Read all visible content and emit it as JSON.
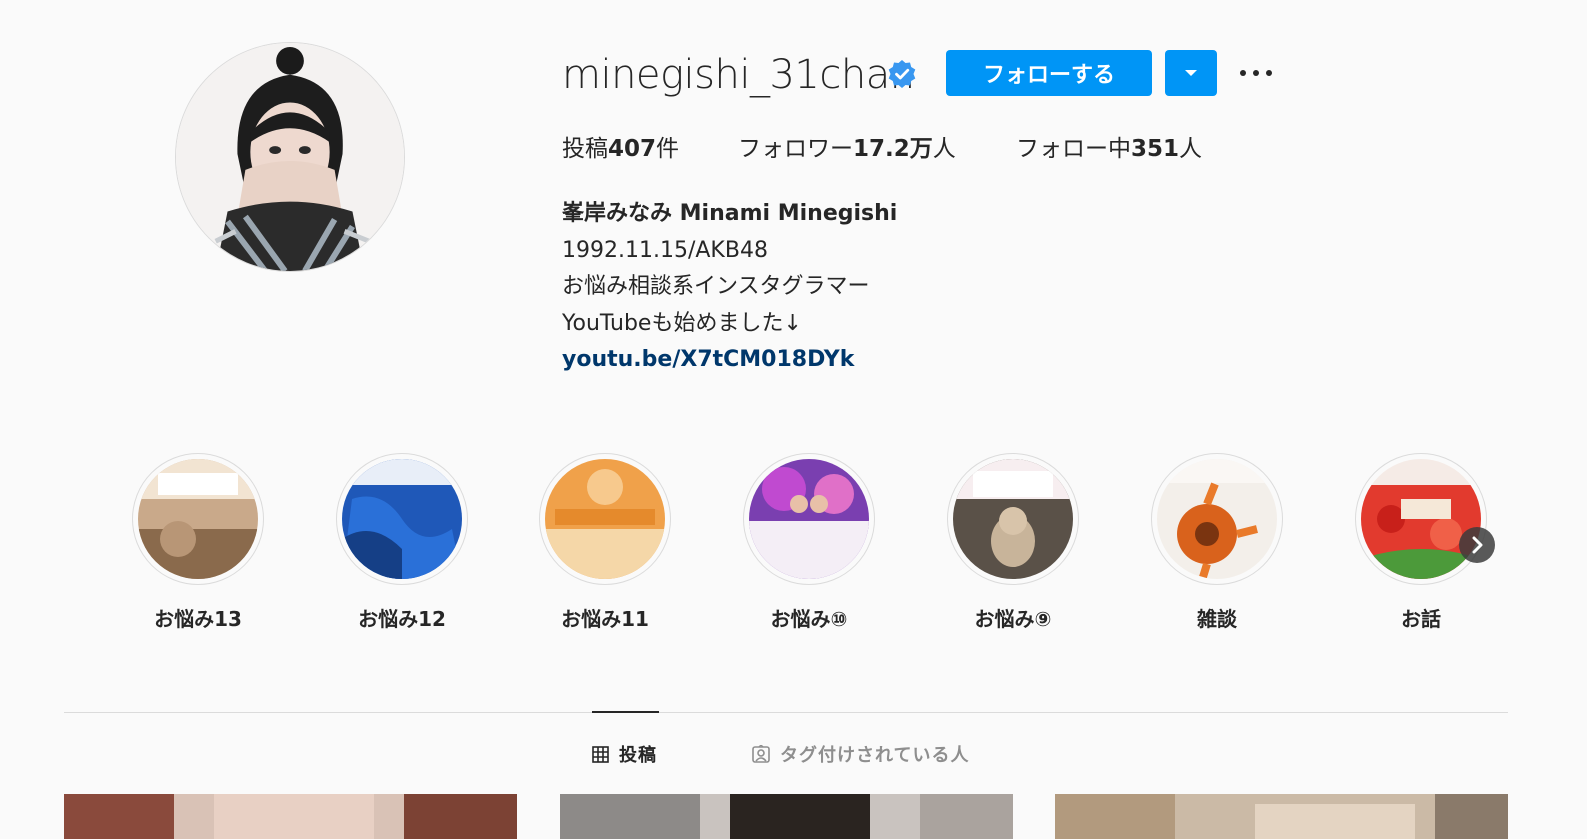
{
  "profile": {
    "username": "minegishi_31chan",
    "verified": true,
    "follow_label": "フォローする",
    "stats": {
      "posts_prefix": "投稿",
      "posts_count": "407",
      "posts_suffix": "件",
      "followers_prefix": "フォロワー",
      "followers_count": "17.2万",
      "followers_suffix": "人",
      "following_prefix": "フォロー中",
      "following_count": "351",
      "following_suffix": "人"
    },
    "bio": {
      "name": "峯岸みなみ Minami Minegishi",
      "line1": "1992.11.15/AKB48",
      "line2": "お悩み相談系インスタグラマー",
      "line3": "YouTubeも始めました↓",
      "link": "youtu.be/X7tCM018DYk"
    }
  },
  "highlights": [
    {
      "label": "お悩み13"
    },
    {
      "label": "お悩み12"
    },
    {
      "label": "お悩み11"
    },
    {
      "label": "お悩み⑩"
    },
    {
      "label": "お悩み⑨"
    },
    {
      "label": "雑談"
    },
    {
      "label": "お話"
    }
  ],
  "tabs": {
    "posts_label": "投稿",
    "tagged_label": "タグ付けされている人",
    "active": "posts"
  },
  "colors": {
    "accent": "#0095f6",
    "verified": "#3897f0",
    "link": "#00376b",
    "background": "#fafafa"
  },
  "icons": {
    "verified": "verified-badge-icon",
    "dropdown": "chevron-down-icon",
    "more": "more-options-icon",
    "next": "chevron-right-icon",
    "grid": "grid-icon",
    "tagged": "tagged-person-icon"
  }
}
